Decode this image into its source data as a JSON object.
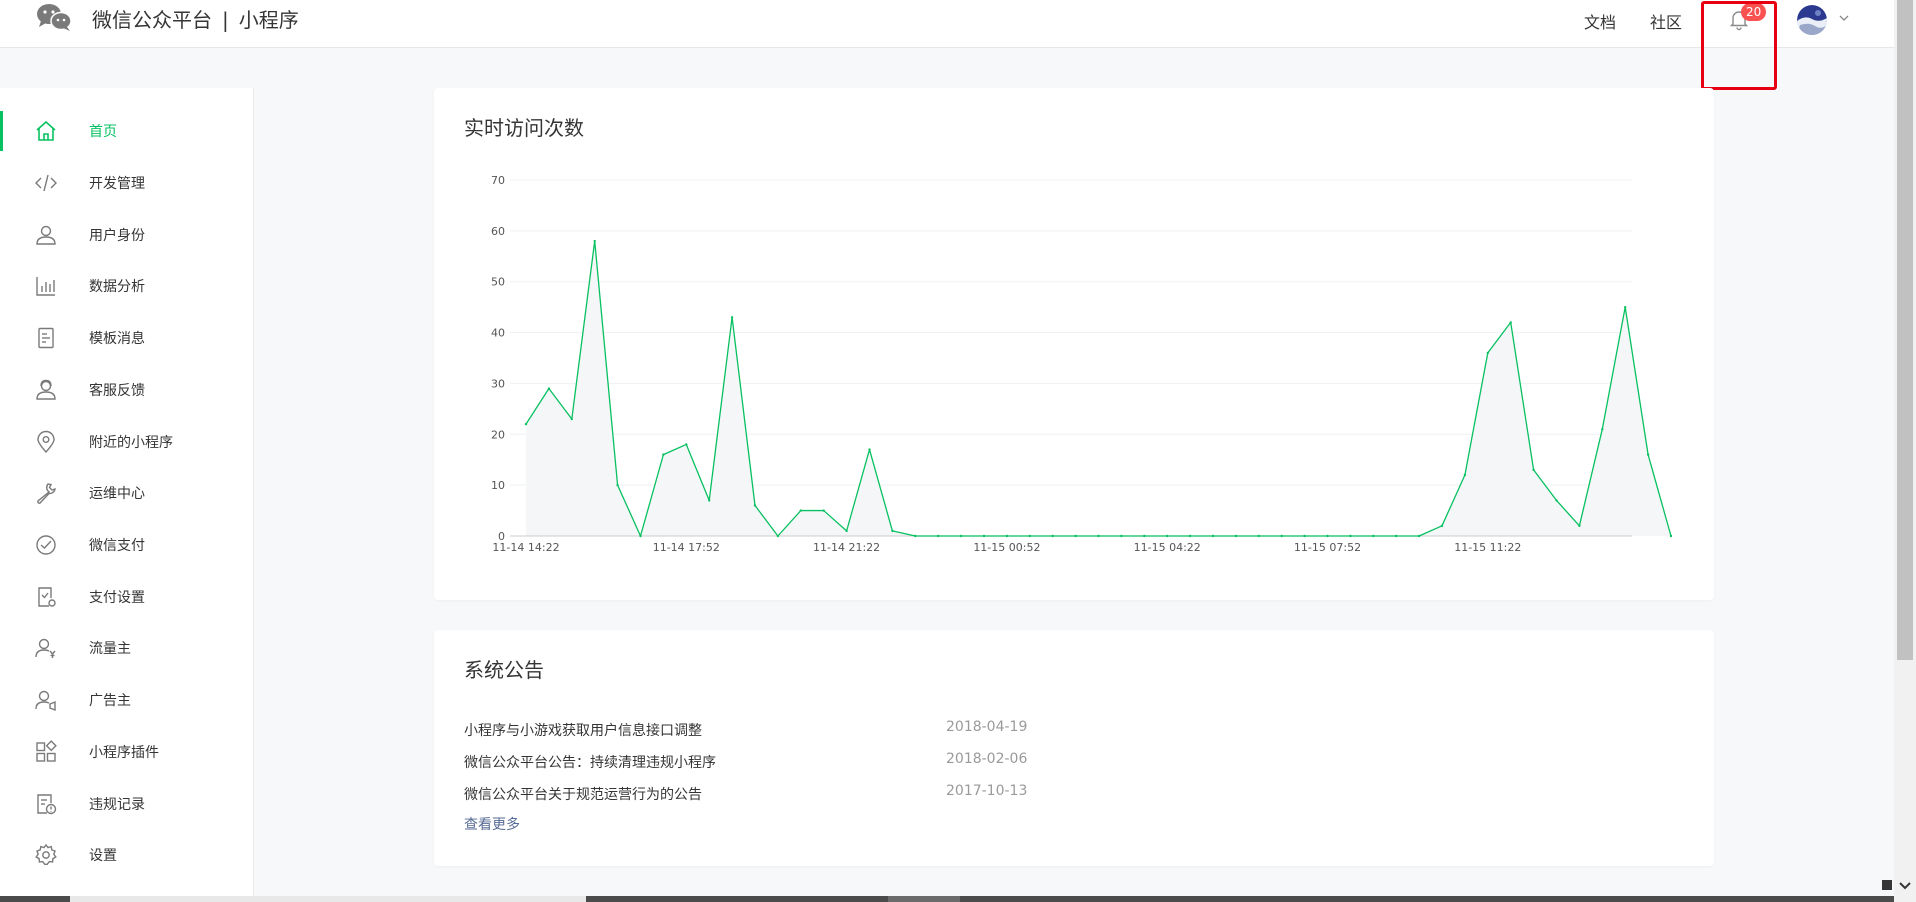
{
  "header": {
    "brand": "微信公众平台",
    "separator": "|",
    "product": "小程序",
    "links": {
      "docs": "文档",
      "community": "社区"
    },
    "notification_count": "20",
    "icons": [
      "wechat-logo-icon",
      "bell-icon",
      "chevron-down-icon"
    ]
  },
  "sidebar": {
    "items": [
      {
        "label": "首页",
        "icon": "home-icon",
        "active": true
      },
      {
        "label": "开发管理",
        "icon": "code-icon"
      },
      {
        "label": "用户身份",
        "icon": "user-icon"
      },
      {
        "label": "数据分析",
        "icon": "bar-chart-icon"
      },
      {
        "label": "模板消息",
        "icon": "document-icon"
      },
      {
        "label": "客服反馈",
        "icon": "customer-service-icon"
      },
      {
        "label": "附近的小程序",
        "icon": "location-pin-icon"
      },
      {
        "label": "运维中心",
        "icon": "wrench-icon"
      },
      {
        "label": "微信支付",
        "icon": "payment-icon"
      },
      {
        "label": "支付设置",
        "icon": "payment-settings-icon"
      },
      {
        "label": "流量主",
        "icon": "traffic-owner-icon"
      },
      {
        "label": "广告主",
        "icon": "advertiser-icon"
      },
      {
        "label": "小程序插件",
        "icon": "plugin-grid-icon"
      },
      {
        "label": "违规记录",
        "icon": "violation-record-icon"
      },
      {
        "label": "设置",
        "icon": "gear-icon"
      }
    ]
  },
  "visits_card": {
    "title": "实时访问次数"
  },
  "chart_data": {
    "type": "area",
    "title": "实时访问次数",
    "xlabel": "",
    "ylabel": "",
    "ylim": [
      0,
      70
    ],
    "yticks": [
      0,
      10,
      20,
      30,
      40,
      50,
      60,
      70
    ],
    "xtick_labels": [
      "11-14 14:22",
      "11-14 17:52",
      "11-14 21:22",
      "11-15 00:52",
      "11-15 04:22",
      "11-15 07:52",
      "11-15 11:22"
    ],
    "interval_minutes": 30,
    "grid": true,
    "colors": {
      "line": "#07c160",
      "fill": "#f4f6f8",
      "grid": "#eef0f2",
      "axis": "#cccccc"
    },
    "series": [
      {
        "values": [
          22,
          29,
          23,
          58,
          10,
          0,
          16,
          18,
          7,
          43,
          6,
          0,
          5,
          5,
          1,
          17,
          1,
          0,
          0,
          0,
          0,
          0,
          0,
          0,
          0,
          0,
          0,
          0,
          0,
          0,
          0,
          0,
          0,
          0,
          0,
          0,
          0,
          0,
          0,
          0,
          2,
          12,
          36,
          42,
          13,
          7,
          2,
          21,
          45,
          16,
          0
        ]
      }
    ]
  },
  "notice_card": {
    "title": "系统公告",
    "items": [
      {
        "title": "小程序与小游戏获取用户信息接口调整",
        "date": "2018-04-19"
      },
      {
        "title": "微信公众平台公告：持续清理违规小程序",
        "date": "2018-02-06"
      },
      {
        "title": "微信公众平台关于规范运营行为的公告",
        "date": "2017-10-13"
      }
    ],
    "more": "查看更多"
  }
}
